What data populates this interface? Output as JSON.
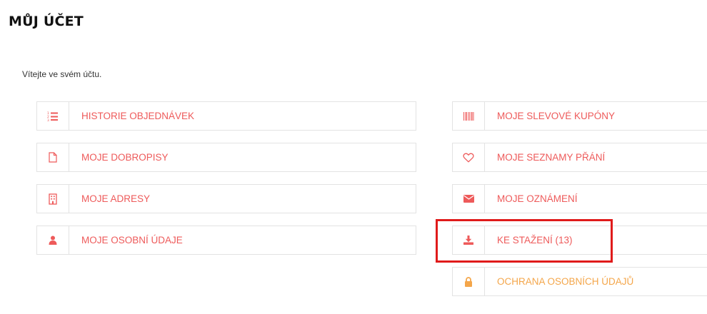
{
  "page": {
    "title": "MŮJ ÚČET",
    "welcome": "Vítejte ve svém účtu."
  },
  "theme": {
    "accent": "#ee5a5a",
    "privacy_accent": "#f4a64a",
    "highlight": "#e01b1b",
    "border": "#e3e3e3"
  },
  "menu": {
    "left": [
      {
        "label": "HISTORIE OBJEDNÁVEK",
        "icon": "list-ordered-icon"
      },
      {
        "label": "MOJE DOBROPISY",
        "icon": "file-icon"
      },
      {
        "label": "MOJE ADRESY",
        "icon": "building-icon"
      },
      {
        "label": "MOJE OSOBNÍ ÚDAJE",
        "icon": "user-icon"
      }
    ],
    "right": [
      {
        "label": "MOJE SLEVOVÉ KUPÓNY",
        "icon": "barcode-icon"
      },
      {
        "label": "MOJE SEZNAMY PŘÁNÍ",
        "icon": "heart-icon"
      },
      {
        "label": "MOJE OZNÁMENÍ",
        "icon": "envelope-icon"
      },
      {
        "label": "KE STAŽENÍ (13)",
        "icon": "download-icon"
      },
      {
        "label": "OCHRANA OSOBNÍCH ÚDAJŮ",
        "icon": "lock-icon"
      }
    ]
  }
}
